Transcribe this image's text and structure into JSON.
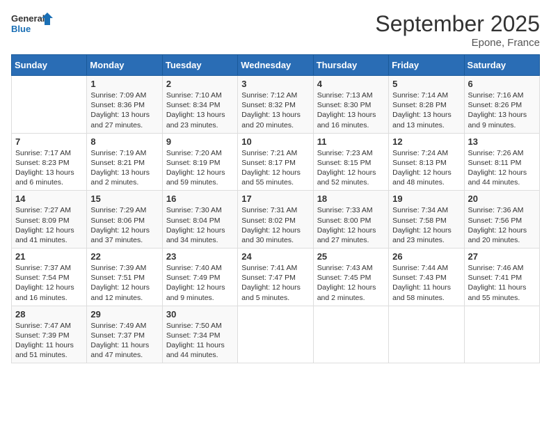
{
  "logo": {
    "general": "General",
    "blue": "Blue"
  },
  "title": "September 2025",
  "location": "Epone, France",
  "days_header": [
    "Sunday",
    "Monday",
    "Tuesday",
    "Wednesday",
    "Thursday",
    "Friday",
    "Saturday"
  ],
  "weeks": [
    [
      {
        "day": "",
        "info": ""
      },
      {
        "day": "1",
        "info": "Sunrise: 7:09 AM\nSunset: 8:36 PM\nDaylight: 13 hours and 27 minutes."
      },
      {
        "day": "2",
        "info": "Sunrise: 7:10 AM\nSunset: 8:34 PM\nDaylight: 13 hours and 23 minutes."
      },
      {
        "day": "3",
        "info": "Sunrise: 7:12 AM\nSunset: 8:32 PM\nDaylight: 13 hours and 20 minutes."
      },
      {
        "day": "4",
        "info": "Sunrise: 7:13 AM\nSunset: 8:30 PM\nDaylight: 13 hours and 16 minutes."
      },
      {
        "day": "5",
        "info": "Sunrise: 7:14 AM\nSunset: 8:28 PM\nDaylight: 13 hours and 13 minutes."
      },
      {
        "day": "6",
        "info": "Sunrise: 7:16 AM\nSunset: 8:26 PM\nDaylight: 13 hours and 9 minutes."
      }
    ],
    [
      {
        "day": "7",
        "info": "Sunrise: 7:17 AM\nSunset: 8:23 PM\nDaylight: 13 hours and 6 minutes."
      },
      {
        "day": "8",
        "info": "Sunrise: 7:19 AM\nSunset: 8:21 PM\nDaylight: 13 hours and 2 minutes."
      },
      {
        "day": "9",
        "info": "Sunrise: 7:20 AM\nSunset: 8:19 PM\nDaylight: 12 hours and 59 minutes."
      },
      {
        "day": "10",
        "info": "Sunrise: 7:21 AM\nSunset: 8:17 PM\nDaylight: 12 hours and 55 minutes."
      },
      {
        "day": "11",
        "info": "Sunrise: 7:23 AM\nSunset: 8:15 PM\nDaylight: 12 hours and 52 minutes."
      },
      {
        "day": "12",
        "info": "Sunrise: 7:24 AM\nSunset: 8:13 PM\nDaylight: 12 hours and 48 minutes."
      },
      {
        "day": "13",
        "info": "Sunrise: 7:26 AM\nSunset: 8:11 PM\nDaylight: 12 hours and 44 minutes."
      }
    ],
    [
      {
        "day": "14",
        "info": "Sunrise: 7:27 AM\nSunset: 8:09 PM\nDaylight: 12 hours and 41 minutes."
      },
      {
        "day": "15",
        "info": "Sunrise: 7:29 AM\nSunset: 8:06 PM\nDaylight: 12 hours and 37 minutes."
      },
      {
        "day": "16",
        "info": "Sunrise: 7:30 AM\nSunset: 8:04 PM\nDaylight: 12 hours and 34 minutes."
      },
      {
        "day": "17",
        "info": "Sunrise: 7:31 AM\nSunset: 8:02 PM\nDaylight: 12 hours and 30 minutes."
      },
      {
        "day": "18",
        "info": "Sunrise: 7:33 AM\nSunset: 8:00 PM\nDaylight: 12 hours and 27 minutes."
      },
      {
        "day": "19",
        "info": "Sunrise: 7:34 AM\nSunset: 7:58 PM\nDaylight: 12 hours and 23 minutes."
      },
      {
        "day": "20",
        "info": "Sunrise: 7:36 AM\nSunset: 7:56 PM\nDaylight: 12 hours and 20 minutes."
      }
    ],
    [
      {
        "day": "21",
        "info": "Sunrise: 7:37 AM\nSunset: 7:54 PM\nDaylight: 12 hours and 16 minutes."
      },
      {
        "day": "22",
        "info": "Sunrise: 7:39 AM\nSunset: 7:51 PM\nDaylight: 12 hours and 12 minutes."
      },
      {
        "day": "23",
        "info": "Sunrise: 7:40 AM\nSunset: 7:49 PM\nDaylight: 12 hours and 9 minutes."
      },
      {
        "day": "24",
        "info": "Sunrise: 7:41 AM\nSunset: 7:47 PM\nDaylight: 12 hours and 5 minutes."
      },
      {
        "day": "25",
        "info": "Sunrise: 7:43 AM\nSunset: 7:45 PM\nDaylight: 12 hours and 2 minutes."
      },
      {
        "day": "26",
        "info": "Sunrise: 7:44 AM\nSunset: 7:43 PM\nDaylight: 11 hours and 58 minutes."
      },
      {
        "day": "27",
        "info": "Sunrise: 7:46 AM\nSunset: 7:41 PM\nDaylight: 11 hours and 55 minutes."
      }
    ],
    [
      {
        "day": "28",
        "info": "Sunrise: 7:47 AM\nSunset: 7:39 PM\nDaylight: 11 hours and 51 minutes."
      },
      {
        "day": "29",
        "info": "Sunrise: 7:49 AM\nSunset: 7:37 PM\nDaylight: 11 hours and 47 minutes."
      },
      {
        "day": "30",
        "info": "Sunrise: 7:50 AM\nSunset: 7:34 PM\nDaylight: 11 hours and 44 minutes."
      },
      {
        "day": "",
        "info": ""
      },
      {
        "day": "",
        "info": ""
      },
      {
        "day": "",
        "info": ""
      },
      {
        "day": "",
        "info": ""
      }
    ]
  ]
}
